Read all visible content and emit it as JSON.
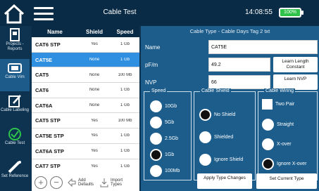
{
  "header": {
    "title": "Cable Test",
    "time": "14:08:55",
    "battery": "100%"
  },
  "sidebar": {
    "items": [
      {
        "label": "Projects - Reports",
        "icon": "projects-icon"
      },
      {
        "label": "Cable Vim",
        "icon": "cable-vim-icon",
        "active": true
      },
      {
        "label": "Cable Labeling",
        "icon": "labeling-icon"
      },
      {
        "label": "Cable Test",
        "icon": "check-circle-icon"
      },
      {
        "label": "Set Reference",
        "icon": "reference-icon"
      }
    ]
  },
  "list": {
    "headers": [
      "Name",
      "Shield",
      "Speed"
    ],
    "rows": [
      {
        "name": "CAT6 STP",
        "shield": "Yes",
        "speed": "1 Gb"
      },
      {
        "name": "CAT5E",
        "shield": "None",
        "speed": "1 Gb",
        "selected": true
      },
      {
        "name": "CAT5",
        "shield": "None",
        "speed": "100 Mb"
      },
      {
        "name": "CAT6",
        "shield": "None",
        "speed": "1 Gb"
      },
      {
        "name": "CAT6A",
        "shield": "None",
        "speed": "1 Gb"
      },
      {
        "name": "CAT5 STP",
        "shield": "Yes",
        "speed": "100 Mb"
      },
      {
        "name": "CAT5E STP",
        "shield": "Yes",
        "speed": "1 Gb"
      },
      {
        "name": "CAT6A STP",
        "shield": "Yes",
        "speed": "1 Gb"
      },
      {
        "name": "CAT7 STP",
        "shield": "Yes",
        "speed": "1 Gb"
      }
    ],
    "tools": {
      "add_defaults": "Add Defaults",
      "import_types": "Import Types"
    }
  },
  "panel": {
    "title": "Cable Type - Cable Days Tag 2 txt",
    "name_label": "Name",
    "name_value": "CAT5E",
    "pfm_label": "pF/m",
    "pfm_value": "49.2",
    "nvp_label": "NVP",
    "nvp_value": "66",
    "learn_length": "Learn Length Constant",
    "learn_nvp": "Learn NVP",
    "speed": {
      "title": "Speed",
      "options": [
        "10Gb",
        "5Gb",
        "2.5Gb",
        "1Gb",
        "100Mb"
      ],
      "selected": "1Gb"
    },
    "shield": {
      "title": "Cable Shield",
      "options": [
        "No Shield",
        "Shielded",
        "Ignore Shield"
      ],
      "selected": "No Shield"
    },
    "wiring": {
      "title": "Cable Wiring",
      "options": [
        "Two Pair",
        "Straight",
        "X-over",
        "Ignore X-over"
      ],
      "selected": "Ignore X-over"
    },
    "apply_button": "Apply Type Changes",
    "set_current_button": "Set Current Type"
  },
  "colors": {
    "background": "#0d3350",
    "panel": "#1c5d8b",
    "selection": "#2f8fe0",
    "battery": "#2ec24a"
  }
}
